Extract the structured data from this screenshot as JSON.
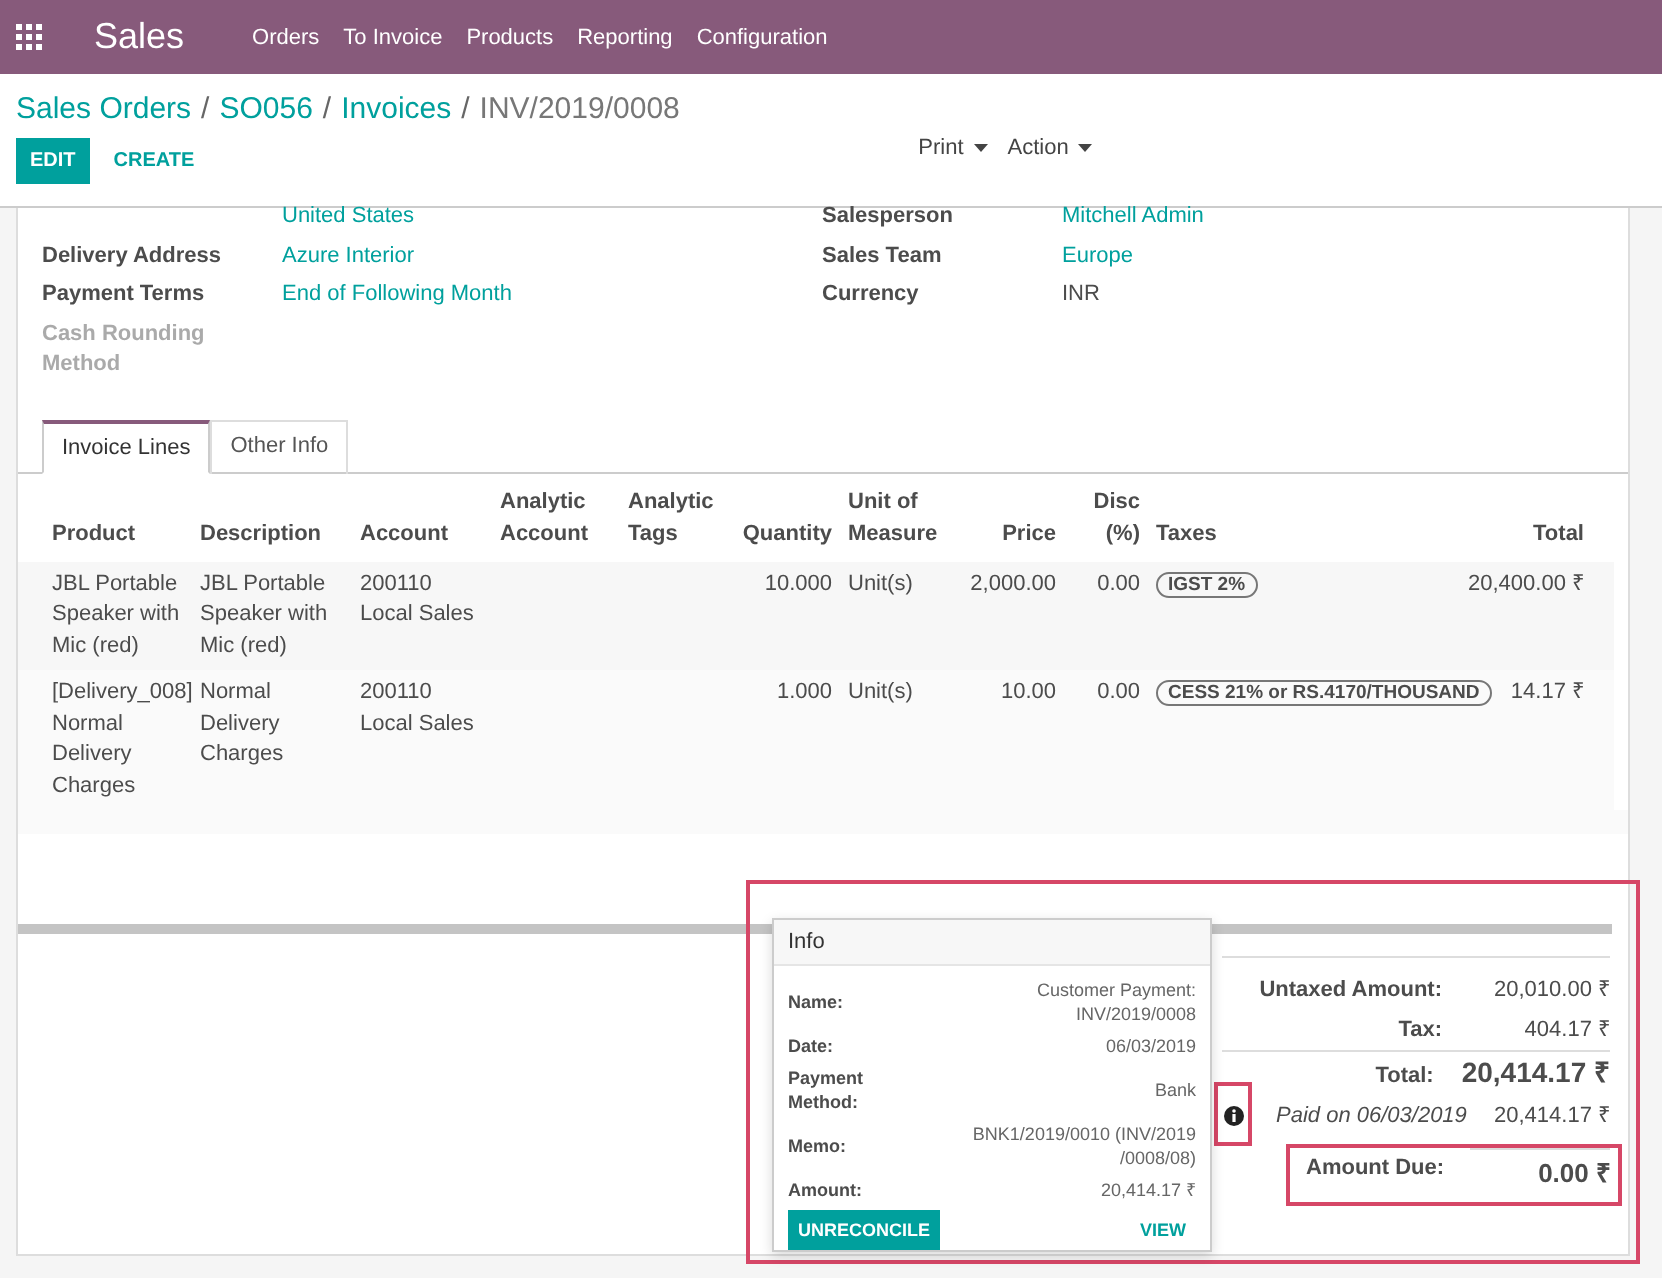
{
  "navbar": {
    "app": "Sales",
    "menu": [
      "Orders",
      "To Invoice",
      "Products",
      "Reporting",
      "Configuration"
    ]
  },
  "breadcrumb": [
    {
      "label": "Sales Orders",
      "link": true
    },
    {
      "separator": "/",
      "label": "SO056",
      "link": true
    },
    {
      "separator": "/",
      "label": "Invoices",
      "link": true
    },
    {
      "separator": "/",
      "label": "INV/2019/0008",
      "link": false
    }
  ],
  "buttons": [
    {
      "label": "EDIT",
      "kind": "primary"
    },
    {
      "label": "CREATE",
      "kind": "link"
    }
  ],
  "dropdowns": [
    "Print",
    "Action"
  ],
  "fields_left": [
    {
      "value": "United States",
      "kind": "link"
    },
    {
      "label": "Delivery Address",
      "value": "Azure Interior",
      "kind": "link"
    },
    {
      "label": "Payment Terms",
      "value": "End of Following Month",
      "kind": "link"
    },
    {
      "label": "Cash Rounding Method",
      "kind": "muted"
    }
  ],
  "fields_right": [
    {
      "label": "Salesperson",
      "value": "Mitchell Admin",
      "kind": "link"
    },
    {
      "label": "Sales Team",
      "value": "Europe",
      "kind": "link"
    },
    {
      "label": "Currency",
      "value": "INR",
      "kind": "text"
    }
  ],
  "tabs": [
    {
      "label": "Invoice Lines",
      "selected": true
    },
    {
      "label": "Other Info",
      "selected": false
    }
  ],
  "table": {
    "columns": [
      {
        "label": "Product",
        "kind": "text"
      },
      {
        "label": "Description",
        "kind": "text"
      },
      {
        "label": "Account",
        "kind": "text"
      },
      {
        "label": "Analytic Account",
        "kind": "text"
      },
      {
        "label": "Analytic Tags",
        "kind": "text"
      },
      {
        "label": "Quantity",
        "kind": "number"
      },
      {
        "label": "Unit of Measure",
        "kind": "text"
      },
      {
        "label": "Price",
        "kind": "number"
      },
      {
        "label": "Disc (%)",
        "kind": "number"
      },
      {
        "label": "Taxes",
        "kind": "tag"
      },
      {
        "label": "Total",
        "kind": "number"
      }
    ],
    "rows": [
      [
        "JBL Portable Speaker with Mic (red)",
        "JBL Portable Speaker with Mic (red)",
        "200110 Local Sales",
        null,
        null,
        "10.000",
        "Unit(s)",
        "2,000.00",
        "0.00",
        "IGST 2%",
        "20,400.00 ₹"
      ],
      [
        "[Delivery_008] Normal Delivery Charges",
        "Normal Delivery Charges",
        "200110 Local Sales",
        null,
        null,
        "1.000",
        "Unit(s)",
        "10.00",
        "0.00",
        "CESS 21% or RS.4170/THOUSAND",
        "14.17 ₹"
      ]
    ]
  },
  "info_popover": {
    "title": "Info",
    "rows": [
      {
        "label": "Name:",
        "value": "Customer Payment: INV/2019/0008"
      },
      {
        "label": "Date:",
        "value": "06/03/2019"
      },
      {
        "label": "Payment Method:",
        "value": "Bank"
      },
      {
        "label": "Memo:",
        "value": "BNK1/2019/0010 (INV/2019 /0008/08)"
      },
      {
        "label": "Amount:",
        "value": "20,414.17 ₹"
      }
    ],
    "buttons": [
      {
        "label": "UNRECONCILE",
        "kind": "primary"
      },
      {
        "label": "VIEW",
        "kind": "link"
      }
    ]
  },
  "totals": [
    {
      "label": "Untaxed Amount:",
      "value": "20,010.00 ₹",
      "kind": "normal"
    },
    {
      "label": "Tax:",
      "value": "404.17 ₹",
      "kind": "normal"
    },
    {
      "label": "Total:",
      "value": "20,414.17 ₹",
      "kind": "total"
    },
    {
      "label": "Paid on 06/03/2019",
      "value": "20,414.17 ₹",
      "kind": "payment"
    },
    {
      "label": "Amount Due:",
      "value": "0.00 ₹",
      "kind": "due"
    }
  ]
}
